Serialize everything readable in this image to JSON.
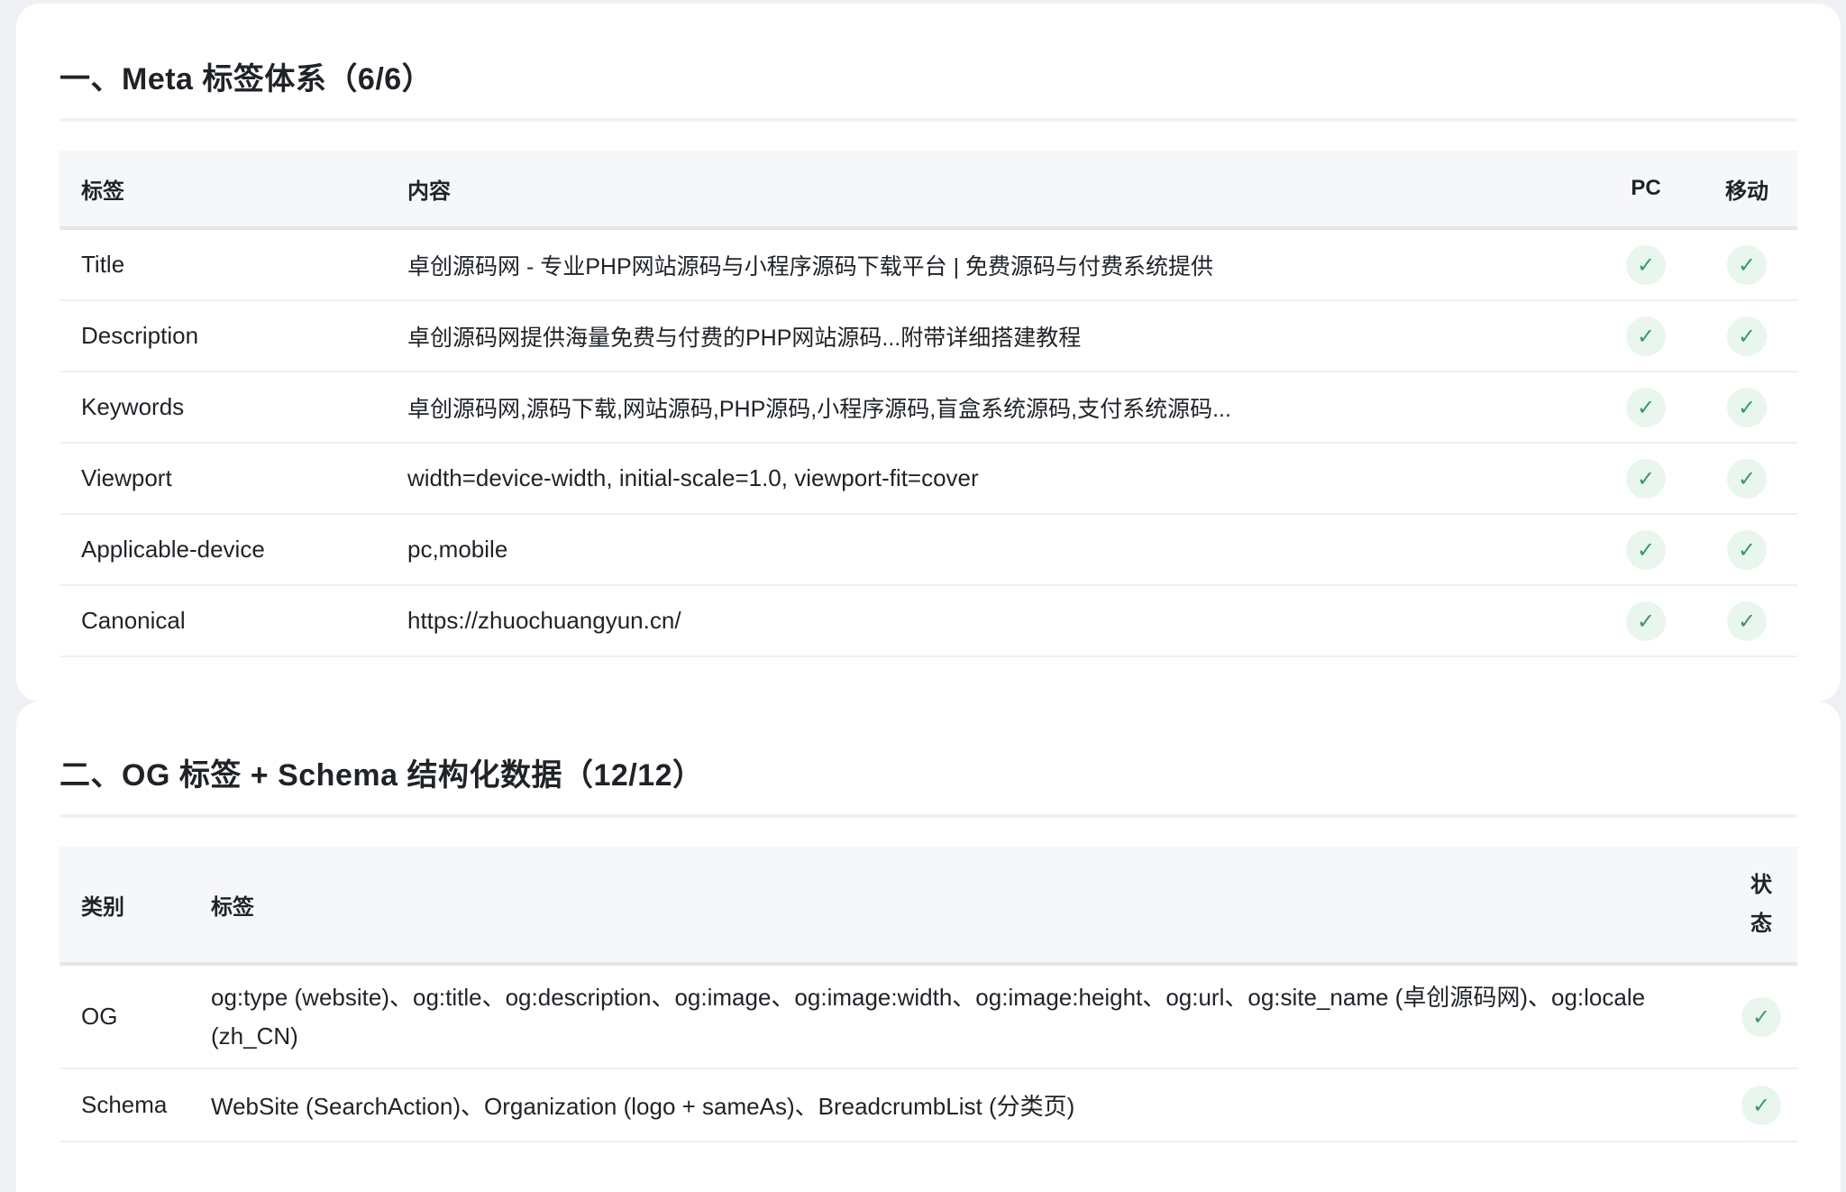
{
  "meta_section": {
    "title": "一、Meta 标签体系（6/6）",
    "columns": {
      "tag": "标签",
      "content": "内容",
      "pc": "PC",
      "mobile": "移动"
    },
    "rows": [
      {
        "tag": "Title",
        "content": "卓创源码网 - 专业PHP网站源码与小程序源码下载平台 | 免费源码与付费系统提供",
        "pc": "✓",
        "mobile": "✓"
      },
      {
        "tag": "Description",
        "content": "卓创源码网提供海量免费与付费的PHP网站源码...附带详细搭建教程",
        "pc": "✓",
        "mobile": "✓"
      },
      {
        "tag": "Keywords",
        "content": "卓创源码网,源码下载,网站源码,PHP源码,小程序源码,盲盒系统源码,支付系统源码...",
        "pc": "✓",
        "mobile": "✓"
      },
      {
        "tag": "Viewport",
        "content": "width=device-width, initial-scale=1.0, viewport-fit=cover",
        "pc": "✓",
        "mobile": "✓"
      },
      {
        "tag": "Applicable-device",
        "content": "pc,mobile",
        "pc": "✓",
        "mobile": "✓"
      },
      {
        "tag": "Canonical",
        "content": "https://zhuochuangyun.cn/",
        "pc": "✓",
        "mobile": "✓"
      }
    ]
  },
  "og_section": {
    "title": "二、OG 标签 + Schema 结构化数据（12/12）",
    "columns": {
      "category": "类别",
      "tags": "标签",
      "status_line1": "状",
      "status_line2": "态"
    },
    "rows": [
      {
        "category": "OG",
        "tags": "og:type (website)、og:title、og:description、og:image、og:image:width、og:image:height、og:url、og:site_name (卓创源码网)、og:locale (zh_CN)",
        "status": "✓"
      },
      {
        "category": "Schema",
        "tags": "WebSite (SearchAction)、Organization (logo + sameAs)、BreadcrumbList (分类页)",
        "status": "✓"
      }
    ]
  },
  "colors": {
    "check_bg": "#e9f6ee",
    "check_fg": "#3a9a63",
    "header_bg": "#f6f7f9",
    "page_bg": "#eef0f3"
  },
  "icons": {
    "status": "check-icon"
  }
}
